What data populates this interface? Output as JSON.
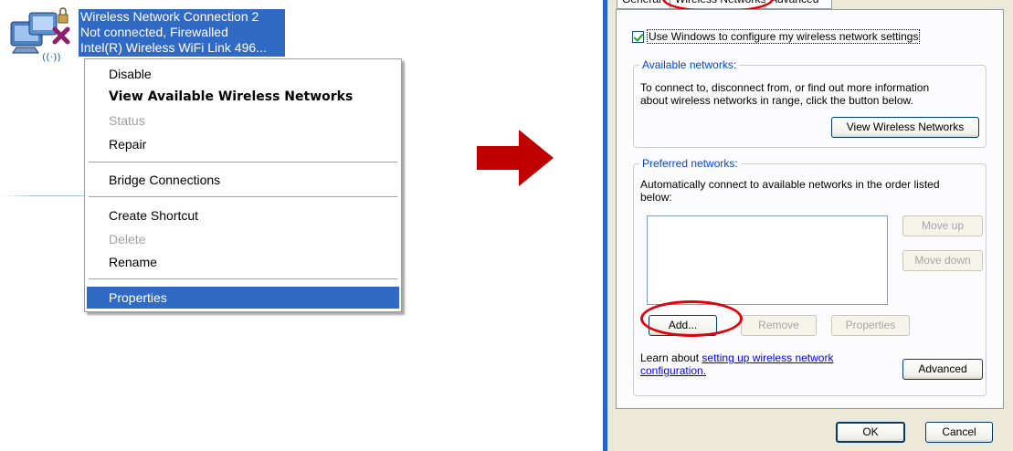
{
  "connection": {
    "name": "Wireless Network Connection 2",
    "status": "Not connected, Firewalled",
    "adapter": "Intel(R) Wireless WiFi Link 496..."
  },
  "context_menu": {
    "items": [
      {
        "label": "Disable",
        "state": "normal"
      },
      {
        "label": "View Available Wireless Networks",
        "state": "default"
      },
      {
        "label": "Status",
        "state": "disabled"
      },
      {
        "label": "Repair",
        "state": "normal"
      },
      {
        "label": "Bridge Connections",
        "state": "normal"
      },
      {
        "label": "Create Shortcut",
        "state": "normal"
      },
      {
        "label": "Delete",
        "state": "disabled"
      },
      {
        "label": "Rename",
        "state": "normal"
      },
      {
        "label": "Properties",
        "state": "highlighted"
      }
    ]
  },
  "dialog": {
    "tabs": {
      "general": "General",
      "wireless": "Wireless Networks",
      "advanced": "Advanced"
    },
    "use_windows_checkbox": {
      "label": "Use Windows to configure my wireless network settings",
      "checked": true
    },
    "available": {
      "title": "Available networks:",
      "description_line1": "To connect to, disconnect from, or find out more information",
      "description_line2": "about wireless networks in range, click the button below.",
      "view_button": "View Wireless Networks"
    },
    "preferred": {
      "title": "Preferred networks:",
      "description_line1": "Automatically connect to available networks in the order listed",
      "description_line2": "below:",
      "move_up": "Move up",
      "move_down": "Move down",
      "add": "Add...",
      "remove": "Remove",
      "properties": "Properties"
    },
    "learn": {
      "prefix": "Learn about ",
      "link_part1": "setting up wireless network",
      "link_part2": "configuration."
    },
    "advanced_button": "Advanced",
    "ok_button": "OK",
    "cancel_button": "Cancel"
  },
  "colors": {
    "highlight": "#316ac5",
    "annotation": "#e0000c",
    "arrow": "#c00000",
    "dialog_face": "#ece9d8"
  }
}
